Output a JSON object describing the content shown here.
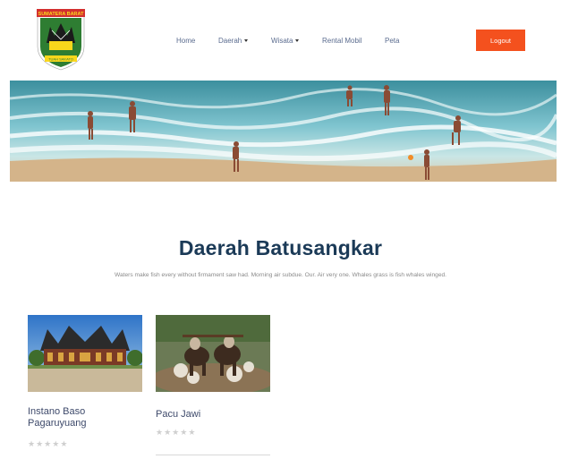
{
  "header": {
    "logo": {
      "banner_text": "SUMATERA BARAT",
      "ribbon_text": "TUAH SAKATO",
      "colors": {
        "banner": "#d32f2f",
        "shield": "#2e7d32",
        "ribbon": "#f9d71c"
      }
    },
    "nav": [
      {
        "label": "Home",
        "dropdown": false
      },
      {
        "label": "Daerah",
        "dropdown": true
      },
      {
        "label": "Wisata",
        "dropdown": true
      },
      {
        "label": "Rental Mobil",
        "dropdown": false
      },
      {
        "label": "Peta",
        "dropdown": false
      }
    ],
    "logout_label": "Logout",
    "colors": {
      "nav_text": "#5b6c8f",
      "logout_bg": "#f4511e"
    }
  },
  "banner": {
    "scene": "beach-with-people-playing-in-waves"
  },
  "main": {
    "title": "Daerah Batusangkar",
    "description": "Waters make fish every without firmament saw had. Morning air subdue. Our. Air very one. Whales grass is fish whales winged.",
    "colors": {
      "title": "#1b3a57"
    }
  },
  "cards": [
    {
      "title": "Instano Baso Pagaruyuang",
      "image": "traditional-minangkabau-palace",
      "rating": 0,
      "max_rating": 5
    },
    {
      "title": "Pacu Jawi",
      "image": "bull-racing-in-mud",
      "rating": 0,
      "max_rating": 5
    }
  ]
}
